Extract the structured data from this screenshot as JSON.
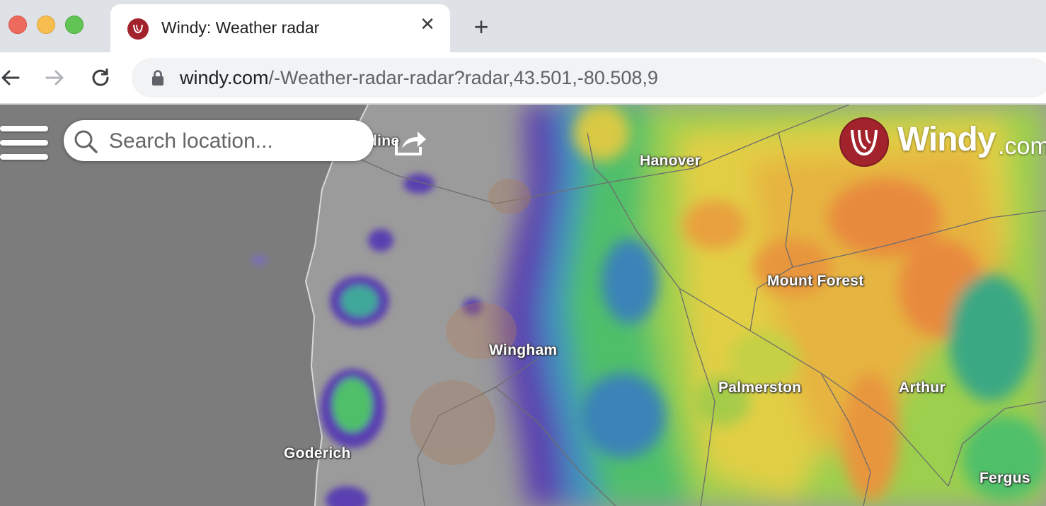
{
  "browser": {
    "tab_title": "Windy: Weather radar",
    "url_host": "windy.com",
    "url_path": "/-Weather-radar-radar?radar,43.501,-80.508,9"
  },
  "map": {
    "search": {
      "placeholder": "Search location..."
    },
    "logo": {
      "word": "Windy",
      "tld": ".com"
    },
    "partial_label": "dine",
    "cities": [
      {
        "name": "Hanover"
      },
      {
        "name": "Mount Forest"
      },
      {
        "name": "Wingham"
      },
      {
        "name": "Palmerston"
      },
      {
        "name": "Arthur"
      },
      {
        "name": "Goderich"
      },
      {
        "name": "Fergus"
      }
    ]
  },
  "colors": {
    "brand": "#a3232d",
    "lake": "#7c7c7c",
    "land": "#9a9a9a",
    "radar_purple": "#5a3fb0",
    "radar_green": "#4fbf6a",
    "radar_yellow": "#e2cf45",
    "radar_orange": "#e89a3d"
  }
}
